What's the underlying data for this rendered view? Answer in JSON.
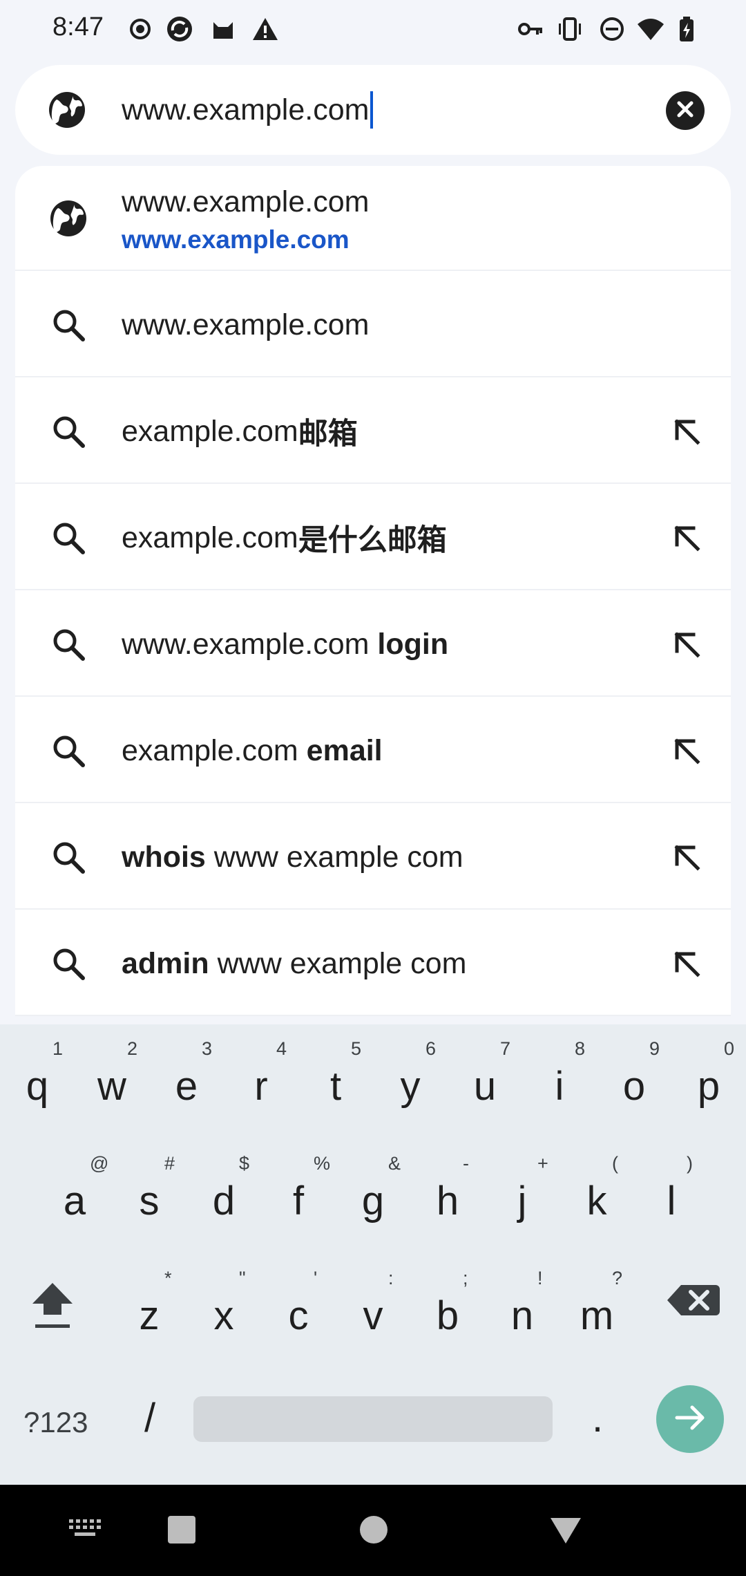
{
  "status_bar": {
    "time": "8:47",
    "left_icons": [
      "record-icon",
      "sync-icon",
      "cat-icon",
      "warning-icon"
    ],
    "right_icons": [
      "vpn-key-icon",
      "vibrate-icon",
      "dnd-icon",
      "wifi-icon",
      "battery-charging-icon"
    ]
  },
  "search": {
    "value": "www.example.com",
    "icon": "globe-icon",
    "clear_icon": "close-icon"
  },
  "suggestions": [
    {
      "icon": "globe-icon",
      "title": "www.example.com",
      "url": "www.example.com"
    },
    {
      "icon": "search-icon",
      "parts": [
        {
          "t": "www.example.com",
          "b": false
        }
      ]
    },
    {
      "icon": "search-icon",
      "parts": [
        {
          "t": "example.com",
          "b": false
        },
        {
          "t": "邮箱",
          "b": true
        }
      ],
      "arrow": true
    },
    {
      "icon": "search-icon",
      "parts": [
        {
          "t": "example.com",
          "b": false
        },
        {
          "t": "是什么邮箱",
          "b": true
        }
      ],
      "arrow": true
    },
    {
      "icon": "search-icon",
      "parts": [
        {
          "t": "www.example.com ",
          "b": false
        },
        {
          "t": "login",
          "b": true
        }
      ],
      "arrow": true
    },
    {
      "icon": "search-icon",
      "parts": [
        {
          "t": "example.com ",
          "b": false
        },
        {
          "t": "email",
          "b": true
        }
      ],
      "arrow": true
    },
    {
      "icon": "search-icon",
      "parts": [
        {
          "t": "whois",
          "b": true
        },
        {
          "t": " www example com",
          "b": false
        }
      ],
      "arrow": true
    },
    {
      "icon": "search-icon",
      "parts": [
        {
          "t": "admin",
          "b": true
        },
        {
          "t": " www example com",
          "b": false
        }
      ],
      "arrow": true
    }
  ],
  "keyboard": {
    "row1": [
      {
        "k": "q",
        "h": "1"
      },
      {
        "k": "w",
        "h": "2"
      },
      {
        "k": "e",
        "h": "3"
      },
      {
        "k": "r",
        "h": "4"
      },
      {
        "k": "t",
        "h": "5"
      },
      {
        "k": "y",
        "h": "6"
      },
      {
        "k": "u",
        "h": "7"
      },
      {
        "k": "i",
        "h": "8"
      },
      {
        "k": "o",
        "h": "9"
      },
      {
        "k": "p",
        "h": "0"
      }
    ],
    "row2": [
      {
        "k": "a",
        "h": "@"
      },
      {
        "k": "s",
        "h": "#"
      },
      {
        "k": "d",
        "h": "$"
      },
      {
        "k": "f",
        "h": "%"
      },
      {
        "k": "g",
        "h": "&"
      },
      {
        "k": "h",
        "h": "-"
      },
      {
        "k": "j",
        "h": "+"
      },
      {
        "k": "k",
        "h": "("
      },
      {
        "k": "l",
        "h": ")"
      }
    ],
    "row3": [
      {
        "k": "z",
        "h": "*"
      },
      {
        "k": "x",
        "h": "\""
      },
      {
        "k": "c",
        "h": "'"
      },
      {
        "k": "v",
        "h": ":"
      },
      {
        "k": "b",
        "h": ";"
      },
      {
        "k": "n",
        "h": "!"
      },
      {
        "k": "m",
        "h": "?"
      }
    ],
    "symbols_label": "?123",
    "slash": "/",
    "period": ".",
    "shift_icon": "shift-icon",
    "backspace_icon": "backspace-icon",
    "enter_icon": "arrow-right-icon",
    "accent": "#6abaa9"
  },
  "nav_bar": {
    "items": [
      "keyboard-switch-icon",
      "recents-icon",
      "home-icon",
      "back-icon"
    ]
  },
  "colors": {
    "background": "#f3f5fa",
    "url_blue": "#1a56c8",
    "caret": "#0b57d0"
  }
}
